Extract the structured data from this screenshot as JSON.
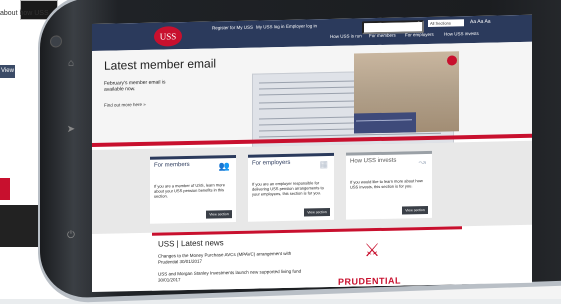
{
  "background_page": {
    "text": "about how USS",
    "view_button": "View"
  },
  "screen": {
    "logo": "USS",
    "top_links": [
      "Register for My USS",
      "My USS log in",
      "Employer log in"
    ],
    "search_placeholder": "",
    "section_selector": "All Sections",
    "font_controls": "Aa Aa Aa",
    "main_nav": [
      "How USS is run",
      "For members",
      "For employers",
      "How USS invests"
    ],
    "hero": {
      "title": "Latest member email",
      "subtitle": "February's member email is available now.",
      "link": "Find out more here »"
    },
    "cards": [
      {
        "title": "For members",
        "body": "If you are a member of USS, learn more about your USS pension benefits in this section.",
        "button": "View section",
        "icon": "members-icon"
      },
      {
        "title": "For employers",
        "body": "If you are an employer responsible for delivering USS pension arrangements to your employees, this section is for you.",
        "button": "View section",
        "icon": "employer-icon"
      },
      {
        "title": "How USS invests",
        "body": "If you would like to learn more about how USS invests, this section is for you.",
        "button": "View section",
        "icon": "chart-icon"
      }
    ],
    "news": {
      "title": "USS | Latest news",
      "items": [
        "Changes to the Money Purchase AVCs (MPAVC) arrangement with Prudential 30/01/2017",
        "USS and Morgan Stanley Investments launch new supported living fund 30/01/2017"
      ],
      "promo_text": "PRUDENTIAL"
    }
  }
}
